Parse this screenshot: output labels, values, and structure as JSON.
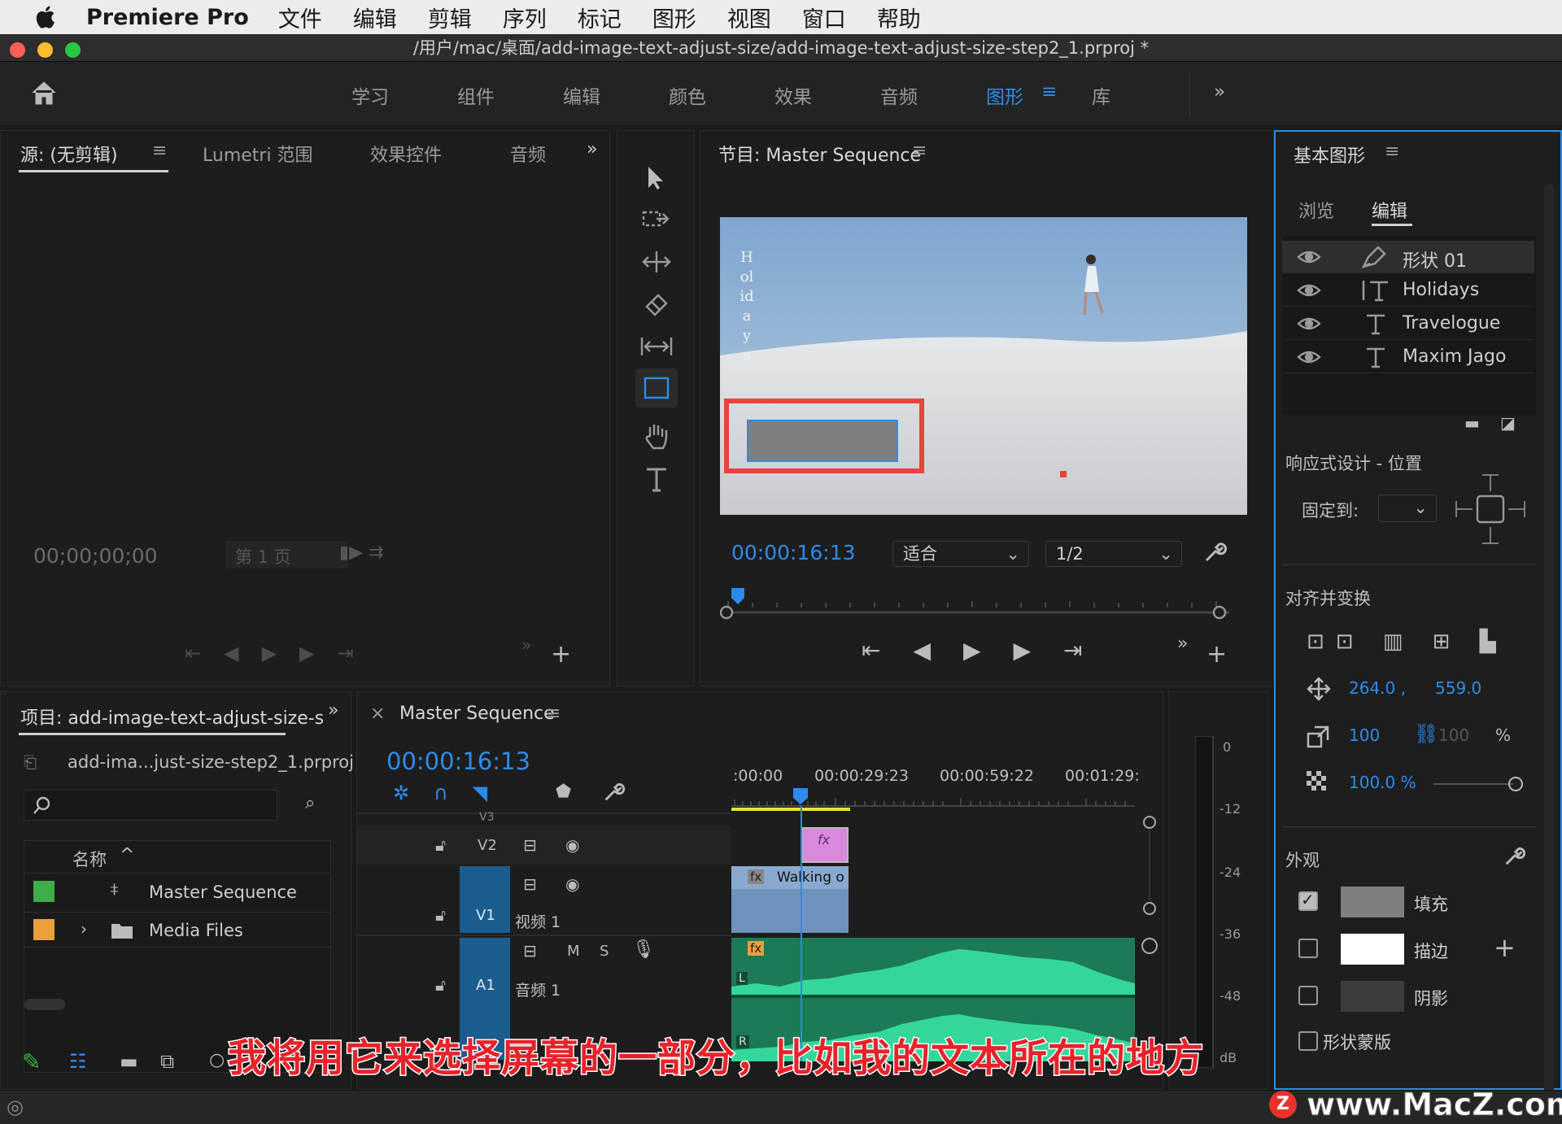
{
  "menubar": {
    "app": "Premiere Pro",
    "items": [
      "文件",
      "编辑",
      "剪辑",
      "序列",
      "标记",
      "图形",
      "视图",
      "窗口",
      "帮助"
    ]
  },
  "window": {
    "title": "/用户/mac/桌面/add-image-text-adjust-size/add-image-text-adjust-size-step2_1.prproj *"
  },
  "workspaces": {
    "tabs": [
      "学习",
      "组件",
      "编辑",
      "颜色",
      "效果",
      "音频",
      "图形",
      "库"
    ],
    "active": "图形"
  },
  "source_panel": {
    "tabs": [
      "源: (无剪辑)",
      "Lumetri 范围",
      "效果控件",
      "音频"
    ],
    "timecode": "00;00;00;00",
    "page": "第 1 页"
  },
  "program_monitor": {
    "title": "节目: Master Sequence",
    "timecode": "00:00:16:13",
    "fit": "适合",
    "resolution": "1/2",
    "overlay_vertical_text": "Holidays"
  },
  "project_panel": {
    "title": "项目: add-image-text-adjust-size-s",
    "file": "add-ima...just-size-step2_1.prproj",
    "column_name": "名称",
    "items": [
      {
        "name": "Master Sequence",
        "color": "#3dae4a"
      },
      {
        "name": "Media Files",
        "color": "#e8a03a"
      }
    ]
  },
  "timeline": {
    "title": "Master Sequence",
    "timecode": "00:00:16:13",
    "ruler": [
      ":00:00",
      "00:00:29:23",
      "00:00:59:22",
      "00:01:29:"
    ],
    "tracks": {
      "v3": "V3",
      "v2": "V2",
      "v1": "V1",
      "v1_name": "视频 1",
      "a1": "A1",
      "a1_name": "音频 1",
      "m": "M",
      "s": "S"
    },
    "clip_v1": "Walking o",
    "fx": "fx",
    "L": "L",
    "R": "R"
  },
  "meter": {
    "labels": [
      "0",
      "-12",
      "-24",
      "-36",
      "-48",
      "dB"
    ]
  },
  "essential_graphics": {
    "title": "基本图形",
    "tabs": [
      "浏览",
      "编辑"
    ],
    "active_tab": "编辑",
    "layers": [
      "形状 01",
      "Holidays",
      "Travelogue",
      "Maxim Jago"
    ],
    "responsive_label": "响应式设计 - 位置",
    "pin_label": "固定到:",
    "align_label": "对齐并变换",
    "pos_x": "264.0 ,",
    "pos_y": "559.0",
    "scale": "100",
    "scale2": "100",
    "percent": "%",
    "opacity": "100.0 %",
    "appearance_label": "外观",
    "fill": "填充",
    "stroke": "描边",
    "shadow": "阴影",
    "mask": "形状蒙版",
    "fill_color": "#7f7f7f",
    "stroke_color": "#ffffff"
  },
  "subtitle": "我将用它来选择屏幕的一部分，比如我的文本所在的地方",
  "watermark": "www.MacZ.com"
}
